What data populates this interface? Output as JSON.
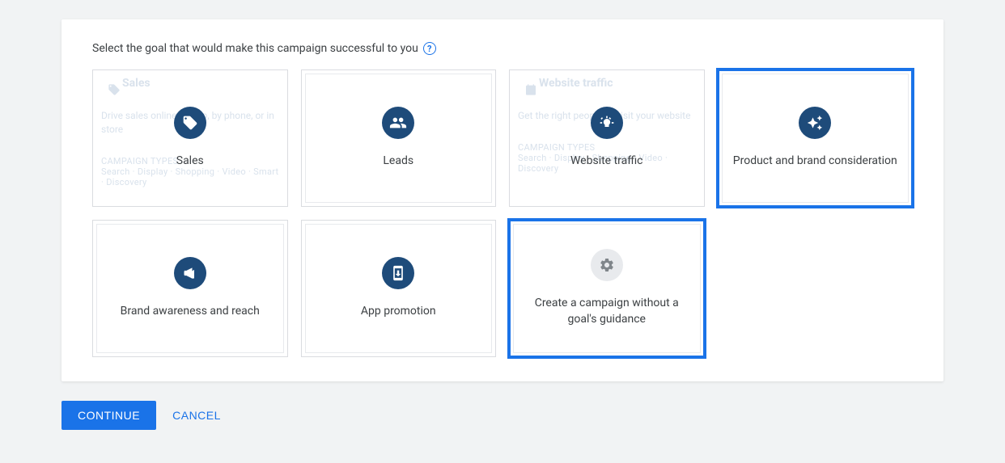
{
  "header": {
    "instruction": "Select the goal that would make this campaign successful to you"
  },
  "goals": {
    "sales": {
      "label": "Sales",
      "ghost_title": "Sales",
      "ghost_body": "Drive sales online, in app, by phone, or in store",
      "ghost_types_label": "CAMPAIGN TYPES",
      "ghost_types": "Search · Display · Shopping · Video · Smart · Discovery"
    },
    "leads": {
      "label": "Leads"
    },
    "website_traffic": {
      "label": "Website traffic",
      "ghost_title": "Website traffic",
      "ghost_body": "Get the right people to visit your website",
      "ghost_types_label": "CAMPAIGN TYPES",
      "ghost_types": "Search · Display · Shopping · Video · Discovery"
    },
    "product_brand": {
      "label": "Product and brand consideration"
    },
    "brand_awareness": {
      "label": "Brand awareness and reach"
    },
    "app_promotion": {
      "label": "App promotion"
    },
    "no_goal": {
      "label": "Create a campaign without a goal's guidance"
    }
  },
  "buttons": {
    "continue": "CONTINUE",
    "cancel": "CANCEL"
  }
}
